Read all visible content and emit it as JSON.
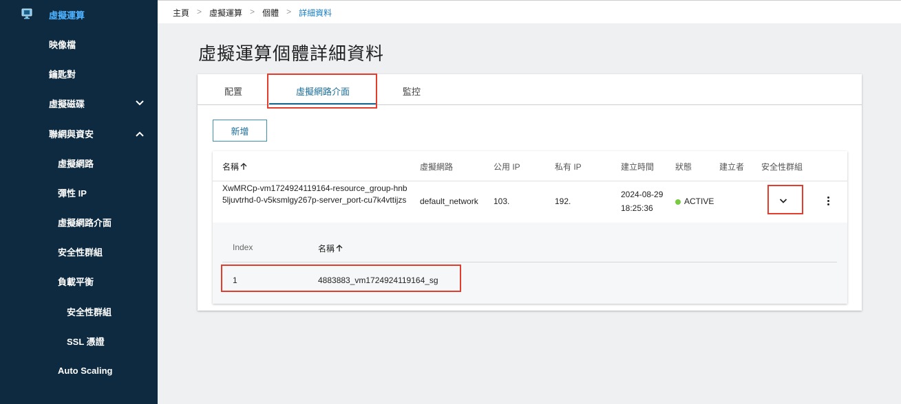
{
  "sidebar": {
    "items": [
      {
        "label": "虛擬運算",
        "active": true,
        "icon": "computer-monitor-icon"
      },
      {
        "label": "映像檔"
      },
      {
        "label": "鑰匙對"
      },
      {
        "label": "虛擬磁碟",
        "chevron": "chevron-down-icon"
      },
      {
        "label": "聯網與資安",
        "chevron": "chevron-up-icon"
      },
      {
        "label": "虛擬網路"
      },
      {
        "label": "彈性 IP"
      },
      {
        "label": "虛擬網路介面"
      },
      {
        "label": "安全性群組"
      },
      {
        "label": "負載平衡"
      },
      {
        "label": "安全性群組"
      },
      {
        "label": "SSL 憑證"
      },
      {
        "label": "Auto Scaling"
      }
    ]
  },
  "breadcrumb": {
    "items": [
      "主頁",
      "虛擬運算",
      "個體",
      "詳細資料"
    ],
    "separator": ">"
  },
  "page": {
    "title": "虛擬運算個體詳細資料"
  },
  "tabs": [
    {
      "label": "配置"
    },
    {
      "label": "虛擬網路介面",
      "active": true
    },
    {
      "label": "監控"
    }
  ],
  "actions": {
    "add_label": "新增"
  },
  "table": {
    "columns": [
      "名稱",
      "虛擬網路",
      "公用 IP",
      "私有 IP",
      "建立時間",
      "狀態",
      "建立者",
      "安全性群組"
    ],
    "sort_icon": "arrow-up-icon",
    "row": {
      "name": "XwMRCp-vm1724924119164-resource_group-hnb5ljuvtrhd-0-v5ksmlgy267p-server_port-cu7k4vttijzs",
      "network": "default_network",
      "public_ip": "103.",
      "private_ip": "192.",
      "created_date": "2024-08-29",
      "created_time": "18:25:36",
      "status": "ACTIVE",
      "creator": "",
      "status_color": "#7ac943"
    }
  },
  "subtable": {
    "columns": [
      "Index",
      "名稱"
    ],
    "rows": [
      {
        "index": "1",
        "name": "4883883_vm1724924119164_sg"
      }
    ]
  },
  "colors": {
    "sidebar_bg": "#0d2a40",
    "accent": "#1a6d98",
    "highlight": "#e43c2c"
  }
}
